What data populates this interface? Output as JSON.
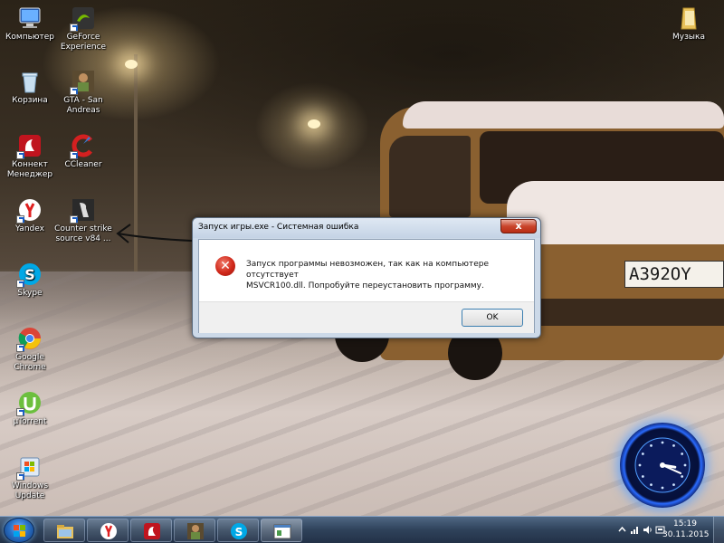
{
  "desktop": {
    "icons": [
      {
        "id": "computer",
        "label": "Компьютер",
        "icon": "computer-icon"
      },
      {
        "id": "geforce",
        "label": "GeForce Experience",
        "icon": "geforce-icon"
      },
      {
        "id": "recycle",
        "label": "Корзина",
        "icon": "recycle-bin-icon"
      },
      {
        "id": "gta",
        "label": "GTA - San Andreas",
        "icon": "gta-icon"
      },
      {
        "id": "connect",
        "label": "Коннект Менеджер",
        "icon": "connect-manager-icon"
      },
      {
        "id": "ccleaner",
        "label": "CCleaner",
        "icon": "ccleaner-icon"
      },
      {
        "id": "yandex",
        "label": "Yandex",
        "icon": "yandex-icon"
      },
      {
        "id": "counterstrike",
        "label": "Counter strike source v84 ...",
        "icon": "counter-strike-icon"
      },
      {
        "id": "skype",
        "label": "Skype",
        "icon": "skype-icon"
      },
      {
        "id": "chrome",
        "label": "Google Chrome",
        "icon": "chrome-icon"
      },
      {
        "id": "utorrent",
        "label": "µTorrent",
        "icon": "utorrent-icon"
      },
      {
        "id": "winupdate",
        "label": "Windows Update",
        "icon": "windows-update-icon"
      },
      {
        "id": "music",
        "label": "Музыка",
        "icon": "folder-icon"
      }
    ],
    "plate_text": "A392OY"
  },
  "dialog": {
    "title": "Запуск игры.exe - Системная ошибка",
    "close_label": "x",
    "message_line1": "Запуск программы невозможен, так как на компьютере отсутствует",
    "message_line2": "MSVCR100.dll. Попробуйте переустановить программу.",
    "ok_label": "OK",
    "icon": "error-icon"
  },
  "gadget": {
    "clock_hour": 3.3,
    "clock_minute": 19
  },
  "taskbar": {
    "items": [
      {
        "id": "explorer",
        "icon": "explorer-folder-icon"
      },
      {
        "id": "yandex",
        "icon": "yandex-icon"
      },
      {
        "id": "opera",
        "icon": "connect-manager-icon"
      },
      {
        "id": "gta",
        "icon": "gta-icon"
      },
      {
        "id": "skype",
        "icon": "skype-icon"
      },
      {
        "id": "error-window",
        "icon": "window-icon"
      }
    ],
    "time": "15:19",
    "date": "30.11.2015"
  },
  "colors": {
    "accent": "#2a72c8",
    "error": "#d0281a"
  }
}
